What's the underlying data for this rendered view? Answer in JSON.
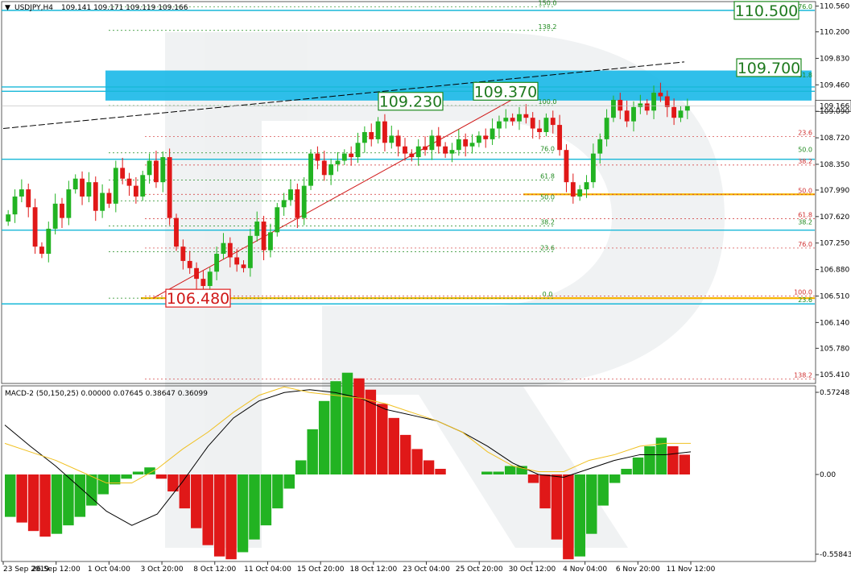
{
  "header": {
    "symbol_label": "USDJPY,H4",
    "ohlc_text": "109.141 109.171 109.119 109.166"
  },
  "macd": {
    "label": "MACD-2 (50,150,25) 0.00000 0.07645 0.38647 0.36099",
    "axis_ticks": [
      "0.57248",
      "0.00",
      "-0.55843"
    ]
  },
  "colors": {
    "bull": "#22b322",
    "bear": "#e01818",
    "support_line": "#18b8d8",
    "zone": "#18b8e8",
    "fib_green": "#1f8a1f",
    "fib_red": "#d03030",
    "fib_yellow": "#f5b400",
    "macd_signal_yellow": "#f0c020",
    "macd_black": "#000000"
  },
  "chart_data": {
    "type": "candlestick",
    "symbol": "USDJPY",
    "timeframe": "H4",
    "ylim": [
      105.3,
      110.6
    ],
    "y_ticks": [
      "110.560",
      "110.200",
      "109.830",
      "109.460",
      "109.166",
      "109.090",
      "108.720",
      "108.350",
      "107.990",
      "107.620",
      "107.250",
      "106.880",
      "106.510",
      "106.140",
      "105.780",
      "105.410"
    ],
    "x_ticks": [
      "23 Sep 2019",
      "26 Sep 12:00",
      "1 Oct 04:00",
      "3 Oct 20:00",
      "8 Oct 12:00",
      "11 Oct 04:00",
      "15 Oct 20:00",
      "18 Oct 12:00",
      "23 Oct 04:00",
      "25 Oct 20:00",
      "30 Oct 12:00",
      "4 Nov 04:00",
      "6 Nov 20:00",
      "11 Nov 12:00"
    ],
    "current_price": 109.166,
    "callouts": [
      {
        "label": "110.500",
        "price": 110.5,
        "style": "green"
      },
      {
        "label": "109.700",
        "price": 109.7,
        "style": "green"
      },
      {
        "label": "109.370",
        "price": 109.37,
        "style": "green"
      },
      {
        "label": "109.230",
        "price": 109.23,
        "style": "green"
      },
      {
        "label": "106.480",
        "price": 106.48,
        "style": "red"
      }
    ],
    "resistance_zone": [
      109.24,
      109.66
    ],
    "horizontal_levels": [
      110.5,
      109.43,
      109.37,
      108.42,
      107.43,
      106.4
    ],
    "fib_retracement_up": [
      {
        "label": "0.0",
        "price": 106.48
      },
      {
        "label": "23.6",
        "price": 107.13
      },
      {
        "label": "38.2",
        "price": 107.49
      },
      {
        "label": "50.0",
        "price": 107.84
      },
      {
        "label": "61.8",
        "price": 108.13
      },
      {
        "label": "76.0",
        "price": 108.51
      },
      {
        "label": "100.0",
        "price": 109.17
      },
      {
        "label": "138.2",
        "price": 110.22
      },
      {
        "label": "150.0",
        "price": 110.55
      },
      {
        "label": "161.8",
        "price": 110.86
      }
    ],
    "fib_retracement_right": [
      {
        "label": "23.6",
        "price": 108.74
      },
      {
        "label": "38.2",
        "price": 108.34
      },
      {
        "label": "50.0",
        "price": 107.93
      },
      {
        "label": "61.8",
        "price": 107.59
      },
      {
        "label": "76.0",
        "price": 107.18
      },
      {
        "label": "100.0",
        "price": 106.51
      },
      {
        "label": "138.2",
        "price": 105.35
      }
    ],
    "fib_right_extra": [
      {
        "label": "76.0",
        "price": 110.5
      },
      {
        "label": "61.8",
        "price": 109.54
      },
      {
        "label": "50.0",
        "price": 108.5
      },
      {
        "label": "38.2",
        "price": 107.49
      },
      {
        "label": "23.6",
        "price": 106.4
      }
    ],
    "trendline_red": [
      {
        "x": "3 Oct 20:00",
        "y": 106.48
      },
      {
        "x": "30 Oct 12:00",
        "y": 109.37
      }
    ],
    "trendline_black": [
      {
        "x": "23 Sep 2019",
        "y": 108.85
      },
      {
        "x": "11 Nov 12:00",
        "y": 109.78
      }
    ],
    "series": [
      {
        "name": "Close",
        "values": [
          107.65,
          107.9,
          108.0,
          107.75,
          107.2,
          107.1,
          107.45,
          107.8,
          107.6,
          108.0,
          108.15,
          107.9,
          108.1,
          107.7,
          107.95,
          107.8,
          108.3,
          108.15,
          108.05,
          107.9,
          108.2,
          108.4,
          108.1,
          108.45,
          107.6,
          107.2,
          107.0,
          106.9,
          106.75,
          106.65,
          106.85,
          107.1,
          107.25,
          107.05,
          106.95,
          106.9,
          107.35,
          107.55,
          107.15,
          107.4,
          107.75,
          107.85,
          108.0,
          107.6,
          108.05,
          108.5,
          108.4,
          108.2,
          108.35,
          108.4,
          108.5,
          108.45,
          108.65,
          108.8,
          108.7,
          108.95,
          108.65,
          108.75,
          108.6,
          108.5,
          108.45,
          108.6,
          108.55,
          108.75,
          108.6,
          108.5,
          108.55,
          108.7,
          108.6,
          108.65,
          108.75,
          108.7,
          108.85,
          108.95,
          109.0,
          108.95,
          109.05,
          109.0,
          108.85,
          108.8,
          109.0,
          108.9,
          108.55,
          108.1,
          107.9,
          108.0,
          108.1,
          108.5,
          108.7,
          109.0,
          109.25,
          109.1,
          108.95,
          109.15,
          109.2,
          109.1,
          109.35,
          109.3,
          109.15,
          109.0,
          109.1,
          109.166
        ]
      }
    ],
    "macd_histogram": [
      -0.3,
      -0.34,
      -0.4,
      -0.44,
      -0.42,
      -0.36,
      -0.3,
      -0.22,
      -0.14,
      -0.07,
      -0.03,
      0.02,
      0.05,
      -0.03,
      -0.12,
      -0.24,
      -0.38,
      -0.5,
      -0.58,
      -0.6,
      -0.55,
      -0.46,
      -0.36,
      -0.24,
      -0.1,
      0.1,
      0.32,
      0.52,
      0.66,
      0.72,
      0.68,
      0.6,
      0.5,
      0.4,
      0.28,
      0.18,
      0.1,
      0.04,
      0.0,
      0.0,
      0.0,
      0.02,
      0.02,
      0.06,
      0.06,
      -0.06,
      -0.24,
      -0.46,
      -0.6,
      -0.58,
      -0.42,
      -0.22,
      -0.06,
      0.04,
      0.12,
      0.2,
      0.26,
      0.2,
      0.14
    ],
    "macd_lines": [
      {
        "name": "black",
        "values": [
          0.35,
          0.2,
          0.06,
          -0.1,
          -0.26,
          -0.36,
          -0.28,
          -0.05,
          0.2,
          0.4,
          0.52,
          0.58,
          0.6,
          0.58,
          0.54,
          0.46,
          0.42,
          0.38,
          0.3,
          0.2,
          0.08,
          0.0,
          -0.02,
          0.04,
          0.1,
          0.14,
          0.14,
          0.16
        ]
      },
      {
        "name": "yellow",
        "values": [
          0.22,
          0.16,
          0.1,
          0.02,
          -0.06,
          -0.06,
          0.04,
          0.18,
          0.3,
          0.44,
          0.56,
          0.62,
          0.58,
          0.56,
          0.54,
          0.5,
          0.44,
          0.38,
          0.3,
          0.16,
          0.06,
          0.02,
          0.02,
          0.1,
          0.14,
          0.2,
          0.22,
          0.22
        ]
      }
    ]
  }
}
